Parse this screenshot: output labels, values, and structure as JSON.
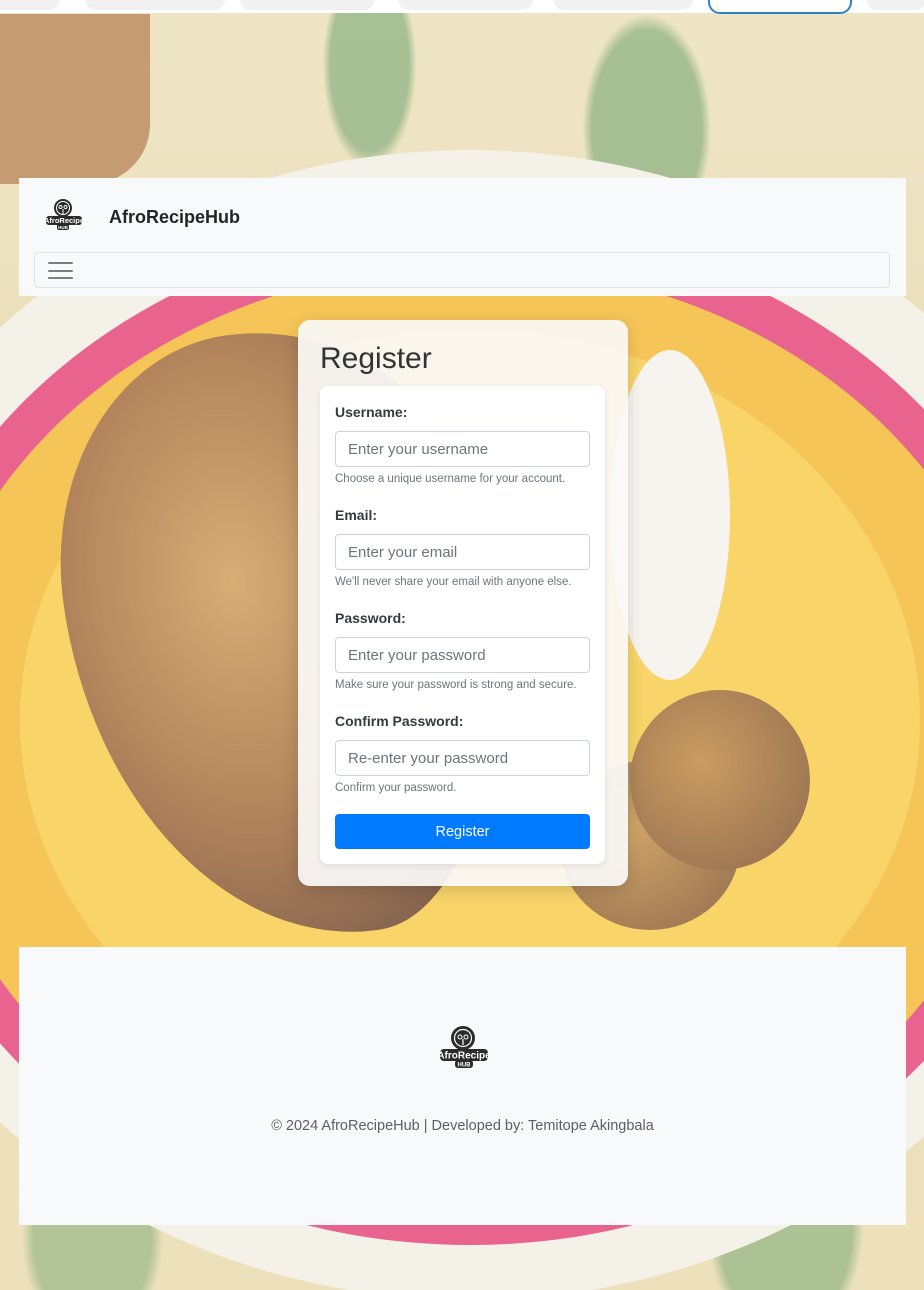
{
  "header": {
    "brand_name": "AfroRecipeHub",
    "logo_text_top": "AfroRecipe",
    "logo_text_bottom": "HUB"
  },
  "register": {
    "title": "Register",
    "fields": [
      {
        "label": "Username:",
        "placeholder": "Enter your username",
        "help": "Choose a unique username for your account."
      },
      {
        "label": "Email:",
        "placeholder": "Enter your email",
        "help": "We'll never share your email with anyone else."
      },
      {
        "label": "Password:",
        "placeholder": "Enter your password",
        "help": "Make sure your password is strong and secure."
      },
      {
        "label": "Confirm Password:",
        "placeholder": "Re-enter your password",
        "help": "Confirm your password."
      }
    ],
    "submit_label": "Register"
  },
  "footer": {
    "copyright": "© 2024 AfroRecipeHub | Developed by: Temitope Akingbala"
  },
  "colors": {
    "primary": "#007bff",
    "navbar_bg": "#f8f9fa",
    "plate_rim": "#e0306a",
    "plate_band": "#f2b21f"
  },
  "icons": {
    "menu": "hamburger-icon",
    "logo": "afrorecipehub-logo"
  }
}
